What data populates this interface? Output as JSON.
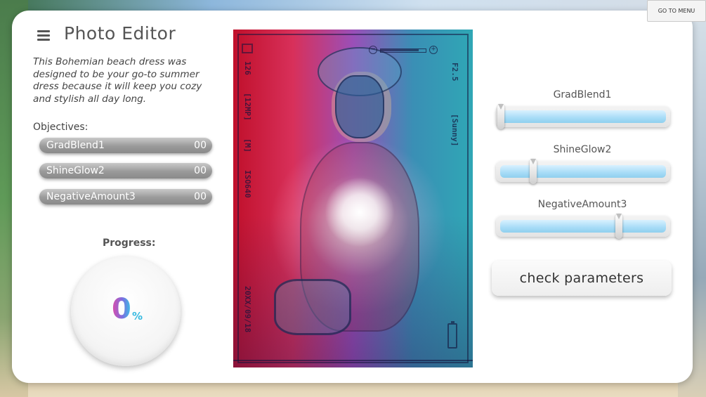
{
  "header": {
    "title": "Photo Editor",
    "menu_button_label": "GO TO MENU"
  },
  "description": "This Bohemian beach dress was designed to be your go-to summer dress because it will keep you cozy and stylish all day long.",
  "objectives": {
    "title": "Objectives:",
    "items": [
      {
        "name": "GradBlend1",
        "value": "00"
      },
      {
        "name": "ShineGlow2",
        "value": "00"
      },
      {
        "name": "NegativeAmount3",
        "value": "00"
      }
    ]
  },
  "progress": {
    "label": "Progress:",
    "value": "0",
    "unit": "%"
  },
  "photo": {
    "camera_overlay": {
      "left_texts": [
        "126",
        "[12MP]",
        "[M]",
        "ISO640"
      ],
      "right_texts": [
        "F2.5",
        "[Sunny]"
      ],
      "date": "20XX/09/18",
      "zoom_minus": "−",
      "zoom_plus": "+",
      "zoom_level": 0.85
    }
  },
  "sliders": [
    {
      "label": "GradBlend1",
      "level": 0.0
    },
    {
      "label": "ShineGlow2",
      "level": 0.2
    },
    {
      "label": "NegativeAmount3",
      "level": 0.73
    }
  ],
  "check_button_label": "check parameters",
  "colors": {
    "accent_pink": "#e04aa8",
    "accent_cyan": "#36c6e6",
    "slider_fill": "#a7dcf7"
  }
}
